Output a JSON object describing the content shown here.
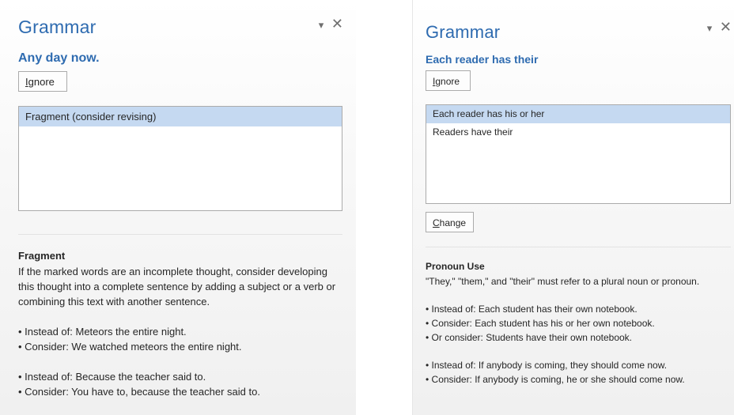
{
  "left_pane": {
    "title": "Grammar",
    "dropdown_glyph": "▾",
    "close_glyph": "✕",
    "error_text": "Any day now.",
    "ignore_label_accel": "I",
    "ignore_label_rest": "gnore",
    "suggestions": [
      "Fragment (consider revising)"
    ],
    "explanation": {
      "heading": "Fragment",
      "description": "If the marked words are an incomplete thought, consider developing this thought into a complete sentence by adding a subject or a verb or combining this text with another sentence.",
      "examples_1": [
        "• Instead of: Meteors the entire night.",
        "• Consider: We watched meteors the entire night."
      ],
      "examples_2": [
        "• Instead of: Because the teacher said to.",
        "• Consider: You have to, because the teacher said to."
      ]
    }
  },
  "right_pane": {
    "title": "Grammar",
    "dropdown_glyph": "▾",
    "close_glyph": "✕",
    "error_text": "Each reader has their",
    "ignore_label_accel": "I",
    "ignore_label_rest": "gnore",
    "change_label_accel": "C",
    "change_label_rest": "hange",
    "suggestions": [
      "Each reader has his or her",
      "Readers have their"
    ],
    "explanation": {
      "heading": "Pronoun Use",
      "description": "\"They,\" \"them,\" and \"their\" must refer to a plural noun or pronoun.",
      "examples_1": [
        "• Instead of: Each student has their own notebook.",
        "• Consider: Each student has his or her own notebook.",
        "• Or consider: Students have their own notebook."
      ],
      "examples_2": [
        "• Instead of: If anybody is coming, they should come now.",
        "• Consider: If anybody is coming, he or she should come now."
      ]
    }
  },
  "colors": {
    "accent_blue": "#2e6bb0",
    "selection": "#c5d9f1"
  }
}
